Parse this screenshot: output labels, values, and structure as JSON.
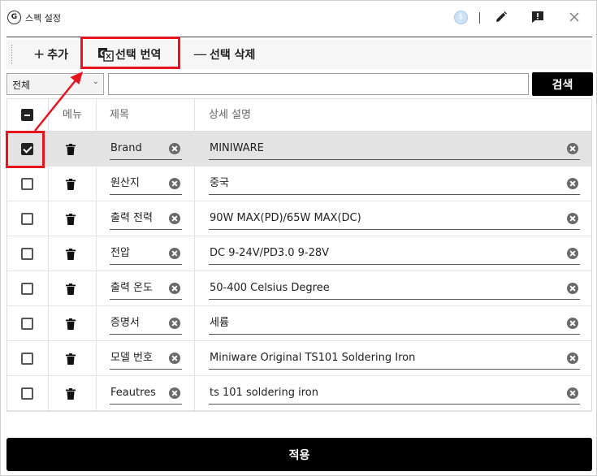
{
  "window": {
    "title": "스펙 설정",
    "badge": "$"
  },
  "toolbar": {
    "add_label": "추가",
    "translate_label": "선택 번역",
    "delete_label": "선택 삭제"
  },
  "search": {
    "filter_value": "전체",
    "query_value": "",
    "button_label": "검색"
  },
  "table": {
    "headers": {
      "menu": "메뉴",
      "title": "제목",
      "description": "상세 설명"
    },
    "rows": [
      {
        "title": "Brand",
        "description": "MINIWARE",
        "checked": true
      },
      {
        "title": "원산지",
        "description": "중국",
        "checked": false
      },
      {
        "title": "출력 전력",
        "description": "90W MAX(PD)/65W MAX(DC)",
        "checked": false
      },
      {
        "title": "전압",
        "description": "DC 9-24V/PD3.0 9-28V",
        "checked": false
      },
      {
        "title": "출력 온도",
        "description": "50-400 Celsius Degree",
        "checked": false
      },
      {
        "title": "증명서",
        "description": "세륨",
        "checked": false
      },
      {
        "title": "모델 번호",
        "description": "Miniware Original TS101 Soldering Iron",
        "checked": false
      },
      {
        "title": "Feautres",
        "description": "ts 101 soldering iron",
        "checked": false
      }
    ]
  },
  "footer": {
    "apply_label": "적용"
  },
  "colors": {
    "highlight": "#e8141d",
    "primary": "#000000",
    "selected_row": "#e3e3e3"
  }
}
